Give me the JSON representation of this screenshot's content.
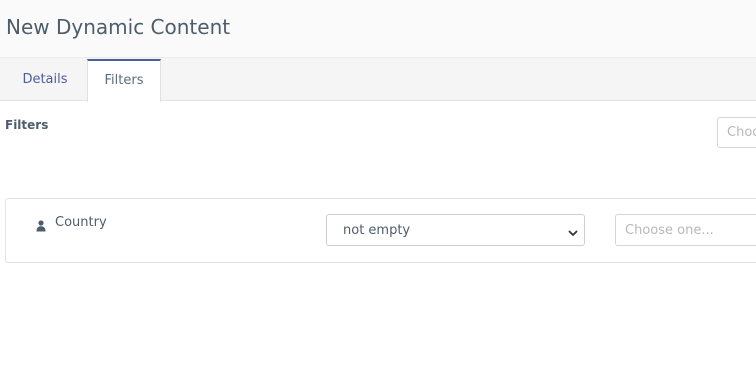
{
  "header": {
    "title": "New Dynamic Content"
  },
  "tabs": [
    {
      "label": "Details",
      "active": false
    },
    {
      "label": "Filters",
      "active": true
    }
  ],
  "filters": {
    "heading": "Filters",
    "field_picker_placeholder": "Choose one...",
    "rows": [
      {
        "icon": "user-icon",
        "field_label": "Country",
        "operator": "not empty",
        "value_placeholder": "Choose one..."
      }
    ]
  },
  "colors": {
    "accent": "#4e5d9c",
    "text": "#4e5d6c",
    "placeholder": "#b8b8b8"
  }
}
